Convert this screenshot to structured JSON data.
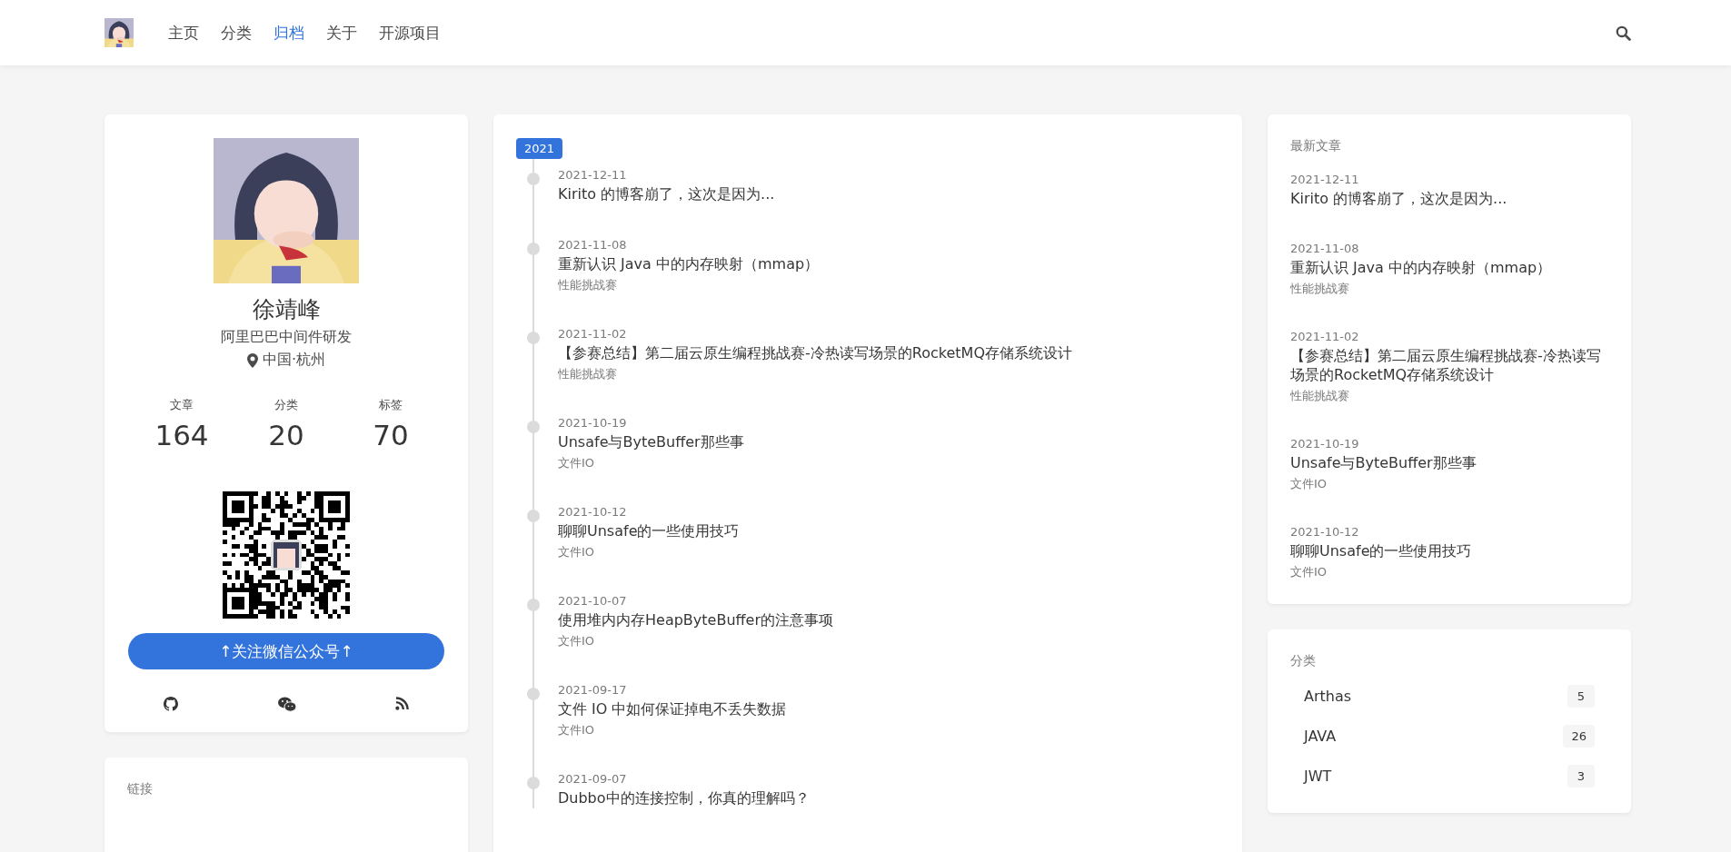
{
  "nav": {
    "items": [
      {
        "label": "主页",
        "selected": false
      },
      {
        "label": "分类",
        "selected": false
      },
      {
        "label": "归档",
        "selected": true
      },
      {
        "label": "关于",
        "selected": false
      },
      {
        "label": "开源项目",
        "selected": false
      }
    ]
  },
  "profile": {
    "name": "徐靖峰",
    "title": "阿里巴巴中间件研发",
    "location": "中国·杭州",
    "stats": [
      {
        "label": "文章",
        "value": "164"
      },
      {
        "label": "分类",
        "value": "20"
      },
      {
        "label": "标签",
        "value": "70"
      }
    ],
    "follow_button": "↑关注微信公众号↑"
  },
  "links": {
    "title": "链接"
  },
  "archive": {
    "year": "2021",
    "posts": [
      {
        "date": "2021-12-11",
        "title": "Kirito 的博客崩了，这次是因为..."
      },
      {
        "date": "2021-11-08",
        "title": "重新认识 Java 中的内存映射（mmap）",
        "category": "性能挑战赛"
      },
      {
        "date": "2021-11-02",
        "title": "【参赛总结】第二届云原生编程挑战赛-冷热读写场景的RocketMQ存储系统设计",
        "category": "性能挑战赛"
      },
      {
        "date": "2021-10-19",
        "title": "Unsafe与ByteBuffer那些事",
        "category": "文件IO"
      },
      {
        "date": "2021-10-12",
        "title": "聊聊Unsafe的一些使用技巧",
        "category": "文件IO"
      },
      {
        "date": "2021-10-07",
        "title": "使用堆内内存HeapByteBuffer的注意事项",
        "category": "文件IO"
      },
      {
        "date": "2021-09-17",
        "title": "文件 IO 中如何保证掉电不丢失数据",
        "category": "文件IO"
      },
      {
        "date": "2021-09-07",
        "title": "Dubbo中的连接控制，你真的理解吗？"
      }
    ]
  },
  "recent": {
    "title": "最新文章",
    "posts": [
      {
        "date": "2021-12-11",
        "title": "Kirito 的博客崩了，这次是因为..."
      },
      {
        "date": "2021-11-08",
        "title": "重新认识 Java 中的内存映射（mmap）",
        "category": "性能挑战赛"
      },
      {
        "date": "2021-11-02",
        "title": "【参赛总结】第二届云原生编程挑战赛-冷热读写场景的RocketMQ存储系统设计",
        "category": "性能挑战赛"
      },
      {
        "date": "2021-10-19",
        "title": "Unsafe与ByteBuffer那些事",
        "category": "文件IO"
      },
      {
        "date": "2021-10-12",
        "title": "聊聊Unsafe的一些使用技巧",
        "category": "文件IO"
      }
    ]
  },
  "categories": {
    "title": "分类",
    "items": [
      {
        "name": "Arthas",
        "count": "5"
      },
      {
        "name": "JAVA",
        "count": "26"
      },
      {
        "name": "JWT",
        "count": "3"
      }
    ]
  }
}
